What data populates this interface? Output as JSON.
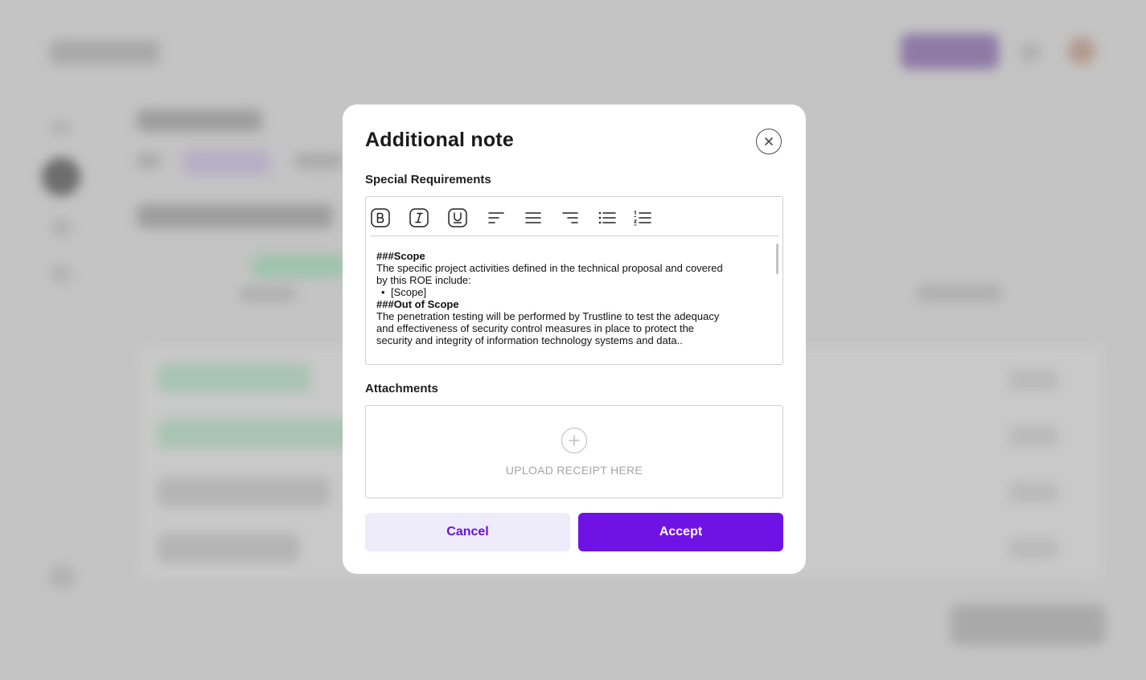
{
  "modal": {
    "title": "Additional note",
    "special_label": "Special Requirements",
    "attachments_label": "Attachments",
    "upload_text": "UPLOAD RECEIPT HERE",
    "cancel_label": "Cancel",
    "accept_label": "Accept"
  },
  "toolbar": {
    "buttons": [
      "bold-icon",
      "italic-icon",
      "underline-icon",
      "align-left-icon",
      "align-center-icon",
      "align-right-icon",
      "bullet-list-icon",
      "numbered-list-icon"
    ]
  },
  "editor": {
    "line1": "###Scope",
    "line2": "The specific project activities defined in the technical proposal and covered",
    "line3": "by this ROE include:",
    "bullet": "[Scope]",
    "line4": "###Out of Scope",
    "line5": "The penetration testing will be performed by Trustline to test the adequacy",
    "line6": "and effectiveness of security control measures in place to protect the",
    "line7": "security and integrity of information technology systems and data.."
  },
  "colors": {
    "accent": "#6f12e6",
    "cancel_bg": "#eeebfb",
    "overlay": "#c4c4c4"
  }
}
